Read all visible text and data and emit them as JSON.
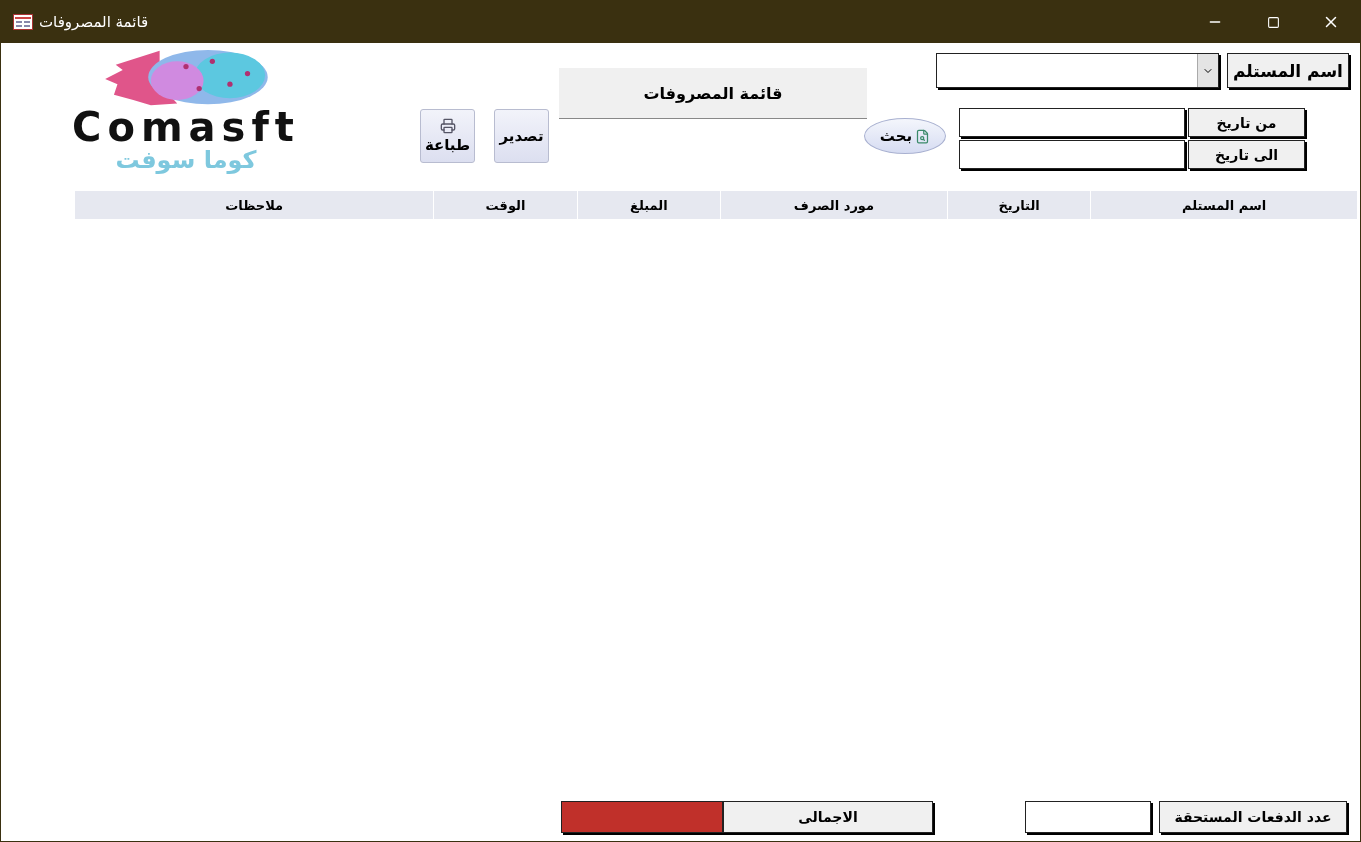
{
  "window": {
    "title": "قائمة المصروفات"
  },
  "logo": {
    "name": "Comasft",
    "subtitle": "كوما سوفت"
  },
  "toolbar": [
    {
      "kind": "print",
      "label": "طباعة"
    },
    {
      "kind": "export",
      "label": "تصدير"
    }
  ],
  "form_title": "قائمة المصروفات",
  "search_button": "بحث",
  "filters": {
    "recipient_label": "اسم المستلم",
    "from_label": "من تاريخ",
    "to_label": "الى  تاريخ"
  },
  "table": {
    "columns": [
      "اسم المستلم",
      "التاريخ",
      "مورد الصرف",
      "المبلغ",
      "الوقت",
      "ملاحظات"
    ]
  },
  "footer": {
    "due_label": "عدد الدفعات المستحقة",
    "total_label": "الاجمالى"
  }
}
